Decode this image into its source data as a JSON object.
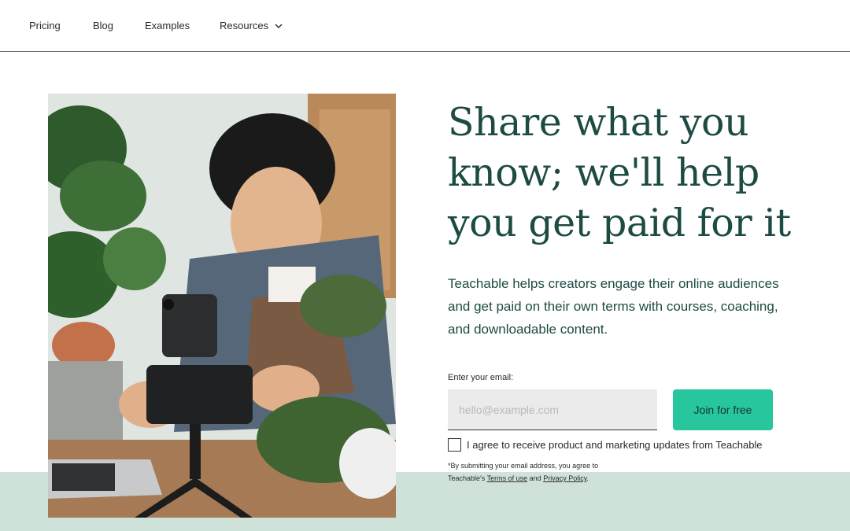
{
  "nav": {
    "items": [
      {
        "label": "Pricing"
      },
      {
        "label": "Blog"
      },
      {
        "label": "Examples"
      },
      {
        "label": "Resources"
      }
    ]
  },
  "hero": {
    "headline": "Share what you know; we'll help you get paid for it",
    "subtext": "Teachable helps creators engage their online audiences and get paid on their own terms with courses, coaching, and downloadable content.",
    "email_label": "Enter your email:",
    "email_placeholder": "hello@example.com",
    "email_value": "",
    "join_button": "Join for free",
    "consent_text": "I agree to receive product and marketing updates from Teachable",
    "fine_print_prefix": "*By submitting your email address, you agree to",
    "fine_print_brand": "Teachable's",
    "terms_link": "Terms of use",
    "fine_print_and": "and",
    "privacy_link": "Privacy Policy",
    "fine_print_end": "."
  },
  "colors": {
    "accent": "#27c69c",
    "headline": "#1d4b43",
    "band": "#cfe2d9"
  },
  "icons": {
    "resources_chevron": "chevron-down-icon"
  }
}
